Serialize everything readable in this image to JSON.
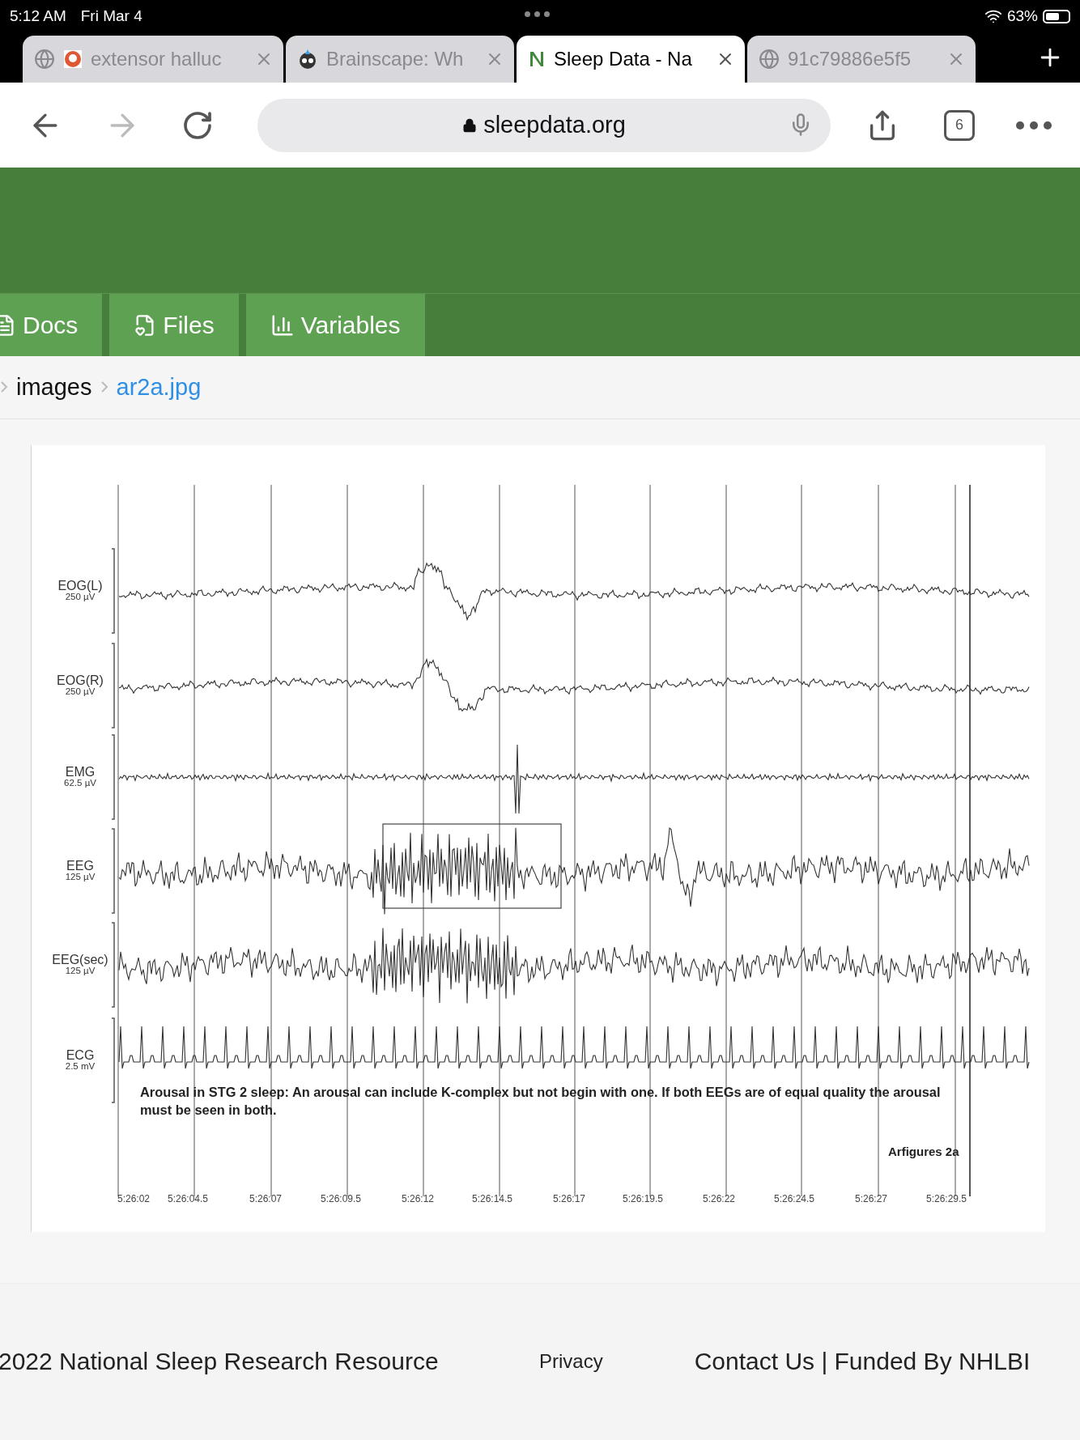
{
  "status_bar": {
    "time": "5:12 AM",
    "date": "Fri Mar 4",
    "battery": "63%"
  },
  "browser_tabs": [
    {
      "title": "extensor halluc",
      "kind": "duck",
      "selected": false
    },
    {
      "title": "Brainscape: Wh",
      "kind": "robot",
      "selected": false
    },
    {
      "title": "Sleep Data - Na",
      "kind": "letter",
      "selected": true
    },
    {
      "title": "91c79886e5f5",
      "kind": "globe",
      "selected": false
    }
  ],
  "address_bar": {
    "url": "sleepdata.org"
  },
  "tab_count": "6",
  "nav_tabs": [
    {
      "label": "Docs",
      "kind": "doc"
    },
    {
      "label": "Files",
      "kind": "file"
    },
    {
      "label": "Variables",
      "kind": "chart"
    }
  ],
  "breadcrumb": [
    {
      "label": "images",
      "kind": "text"
    },
    {
      "label": "ar2a.jpg",
      "kind": "link"
    }
  ],
  "figure": {
    "channels": [
      {
        "name": "EOG(L)",
        "scale": "250 µV",
        "kind": "eog"
      },
      {
        "name": "EOG(R)",
        "scale": "250 µV",
        "kind": "eog"
      },
      {
        "name": "EMG",
        "scale": "62.5 µV",
        "kind": "emg"
      },
      {
        "name": "EEG",
        "scale": "125 µV",
        "kind": "eeg"
      },
      {
        "name": "EEG(sec)",
        "scale": "125 µV",
        "kind": "eeg"
      },
      {
        "name": "ECG",
        "scale": "2.5 mV",
        "kind": "ecg"
      }
    ],
    "caption": "Arousal in STG 2 sleep:  An arousal can include K-complex but not begin with one.  If both EEGs are of equal quality the arousal must be seen in both.",
    "label": "Arfigures 2a",
    "times": [
      "5:26:02",
      "5:26:04.5",
      "5:26:07",
      "5:26:09.5",
      "5:26:12",
      "5:26:14.5",
      "5:26:17",
      "5:26:19.5",
      "5:26:22",
      "5:26:24.5",
      "5:26:27",
      "5:26:29.5"
    ]
  },
  "footer": {
    "copyright": "2022 National Sleep Research Resource",
    "privacy": "Privacy",
    "contact": "Contact Us | Funded By NHLBI"
  }
}
